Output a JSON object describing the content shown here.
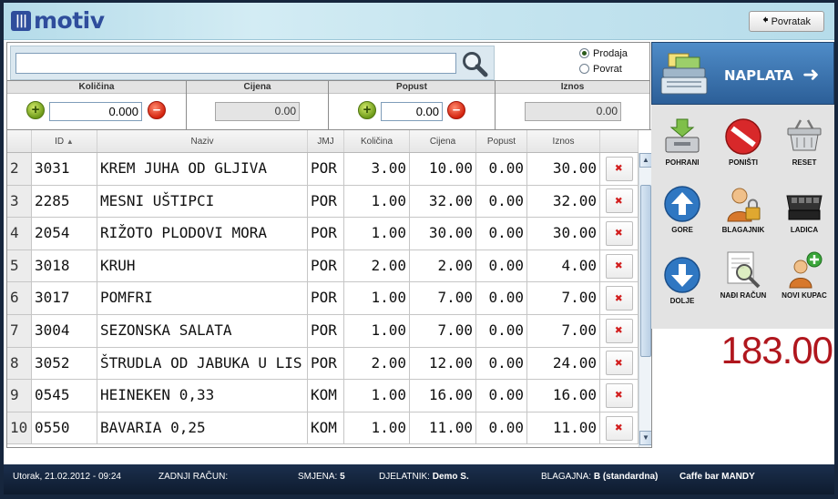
{
  "header": {
    "logo_text": "motiv",
    "back_label": "Povratak"
  },
  "search": {
    "value": "",
    "placeholder": ""
  },
  "mode": {
    "options": [
      "Prodaja",
      "Povrat"
    ],
    "selected": "Prodaja"
  },
  "fields": {
    "kolicina": {
      "label": "Količina",
      "value": "0.000"
    },
    "cijena": {
      "label": "Cijena",
      "value": "0.00"
    },
    "popust": {
      "label": "Popust",
      "value": "0.00"
    },
    "iznos": {
      "label": "Iznos",
      "value": "0.00"
    }
  },
  "table": {
    "columns": [
      "",
      "ID",
      "Naziv",
      "JMJ",
      "Količina",
      "Cijena",
      "Popust",
      "Iznos",
      ""
    ],
    "sort_column": "ID",
    "rows": [
      {
        "n": "2",
        "id": "3031",
        "name": "KREM JUHA OD GLJIVA",
        "unit": "POR",
        "qty": "3.00",
        "price": "10.00",
        "discount": "0.00",
        "amount": "30.00"
      },
      {
        "n": "3",
        "id": "2285",
        "name": "MESNI UŠTIPCI",
        "unit": "POR",
        "qty": "1.00",
        "price": "32.00",
        "discount": "0.00",
        "amount": "32.00"
      },
      {
        "n": "4",
        "id": "2054",
        "name": "RIŽOTO PLODOVI MORA",
        "unit": "POR",
        "qty": "1.00",
        "price": "30.00",
        "discount": "0.00",
        "amount": "30.00"
      },
      {
        "n": "5",
        "id": "3018",
        "name": "KRUH",
        "unit": "POR",
        "qty": "2.00",
        "price": "2.00",
        "discount": "0.00",
        "amount": "4.00"
      },
      {
        "n": "6",
        "id": "3017",
        "name": "POMFRI",
        "unit": "POR",
        "qty": "1.00",
        "price": "7.00",
        "discount": "0.00",
        "amount": "7.00"
      },
      {
        "n": "7",
        "id": "3004",
        "name": "SEZONSKA SALATA",
        "unit": "POR",
        "qty": "1.00",
        "price": "7.00",
        "discount": "0.00",
        "amount": "7.00"
      },
      {
        "n": "8",
        "id": "3052",
        "name": "ŠTRUDLA OD JABUKA U LIS",
        "unit": "POR",
        "qty": "2.00",
        "price": "12.00",
        "discount": "0.00",
        "amount": "24.00"
      },
      {
        "n": "9",
        "id": "0545",
        "name": "HEINEKEN 0,33",
        "unit": "KOM",
        "qty": "1.00",
        "price": "16.00",
        "discount": "0.00",
        "amount": "16.00"
      },
      {
        "n": "10",
        "id": "0550",
        "name": "BAVARIA 0,25",
        "unit": "KOM",
        "qty": "1.00",
        "price": "11.00",
        "discount": "0.00",
        "amount": "11.00"
      }
    ]
  },
  "payment": {
    "label": "NAPLATA"
  },
  "actions": [
    {
      "key": "pohrani",
      "label": "POHRANI",
      "icon": "save-drawer-icon"
    },
    {
      "key": "ponisti",
      "label": "PONIŠTI",
      "icon": "no-entry-icon"
    },
    {
      "key": "reset",
      "label": "RESET",
      "icon": "basket-icon"
    },
    {
      "key": "gore",
      "label": "GORE",
      "icon": "arrow-up-icon"
    },
    {
      "key": "blagajnik",
      "label": "BLAGAJNIK",
      "icon": "cashier-lock-icon"
    },
    {
      "key": "ladica",
      "label": "LADICA",
      "icon": "cash-drawer-icon"
    },
    {
      "key": "dolje",
      "label": "DOLJE",
      "icon": "arrow-down-icon"
    },
    {
      "key": "nadi",
      "label": "NAĐI RAČUN",
      "icon": "find-receipt-icon"
    },
    {
      "key": "novi",
      "label": "NOVI KUPAC",
      "icon": "add-customer-icon"
    }
  ],
  "total": "183.00",
  "status": {
    "datetime": "Utorak, 21.02.2012 - 09:24",
    "last_receipt_label": "ZADNJI RAČUN:",
    "shift_label": "SMJENA:",
    "shift_value": "5",
    "employee_label": "DJELATNIK:",
    "employee_value": "Demo S.",
    "register_label": "BLAGAJNA:",
    "register_value": "B (standardna)",
    "venue": "Caffe bar MANDY"
  },
  "colors": {
    "header_bg": "#c4e4ef",
    "brand": "#2f4d9c",
    "pay_button": "#3d77b3",
    "total": "#b0161d",
    "status_bar": "#16263d",
    "delete": "#d21f1f"
  }
}
